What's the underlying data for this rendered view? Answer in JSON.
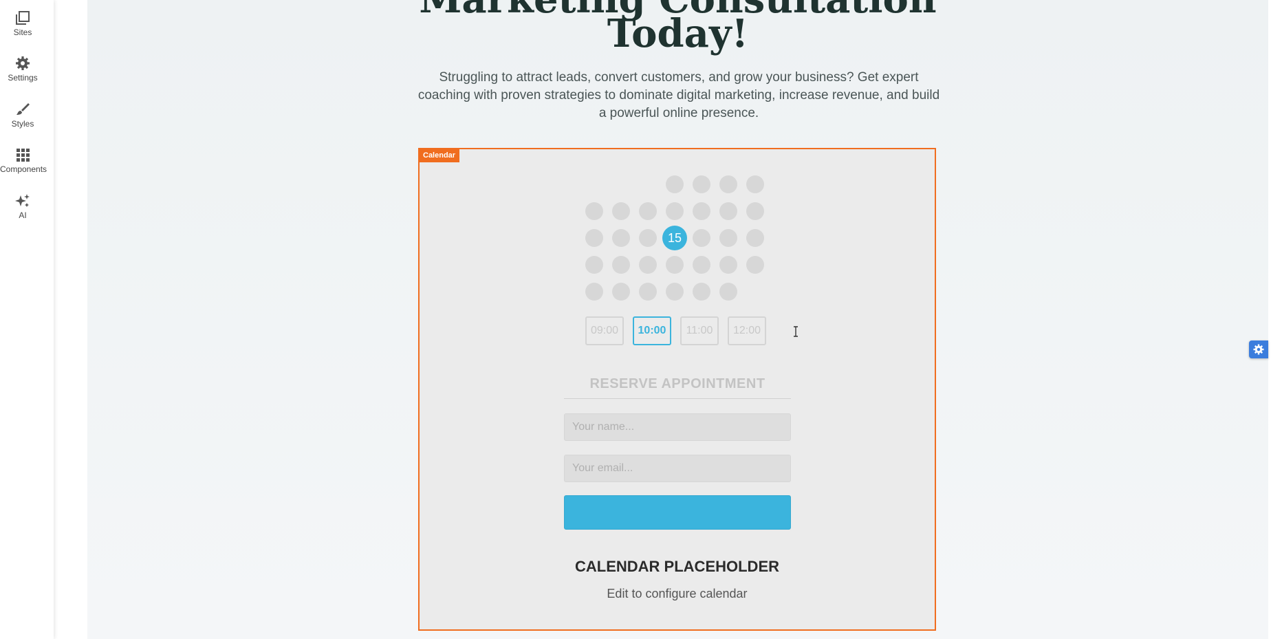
{
  "sidebar": {
    "items": [
      {
        "label": "Sites",
        "icon": "sites-icon"
      },
      {
        "label": "Settings",
        "icon": "gear-icon"
      },
      {
        "label": "Styles",
        "icon": "brush-icon"
      },
      {
        "label": "Components",
        "icon": "grid-icon"
      },
      {
        "label": "AI",
        "icon": "sparkle-icon"
      }
    ]
  },
  "hero": {
    "headline_line1": "Marketing Consultation",
    "headline_line2": "Today!",
    "subtitle": "Struggling to attract leads, convert customers, and grow your business? Get expert coaching with proven strategies to dominate digital marketing, increase revenue, and build a powerful online presence."
  },
  "calendar": {
    "tag": "Calendar",
    "selected_day": "15",
    "time_slots": [
      "09:00",
      "10:00",
      "11:00",
      "12:00"
    ],
    "active_slot": "10:00",
    "reserve_title": "RESERVE APPOINTMENT",
    "name_placeholder": "Your name...",
    "email_placeholder": "Your email...",
    "placeholder_title": "CALENDAR PLACEHOLDER",
    "placeholder_subtitle": "Edit to configure calendar"
  },
  "colors": {
    "accent": "#3bb4dd",
    "selection_border": "#f06d1f",
    "headline": "#1f3330",
    "settings_button": "#3b7ddd"
  }
}
